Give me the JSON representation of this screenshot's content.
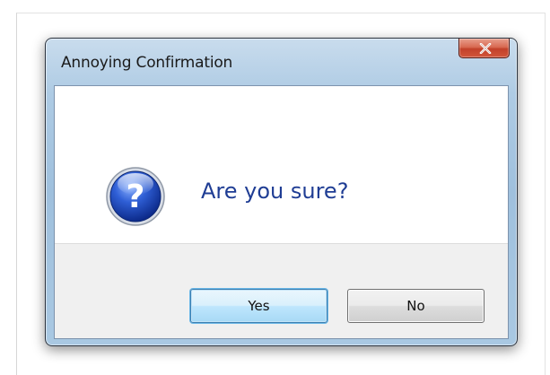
{
  "dialog": {
    "title": "Annoying Confirmation",
    "message": "Are you sure?",
    "icon": "question-icon",
    "close_icon": "close-icon"
  },
  "buttons": {
    "yes_label": "Yes",
    "no_label": "No"
  },
  "colors": {
    "message_text": "#1f3d94",
    "titlebar": "#a9c8e2",
    "close_button": "#c2412a",
    "default_button_border": "#3c7fb1"
  }
}
